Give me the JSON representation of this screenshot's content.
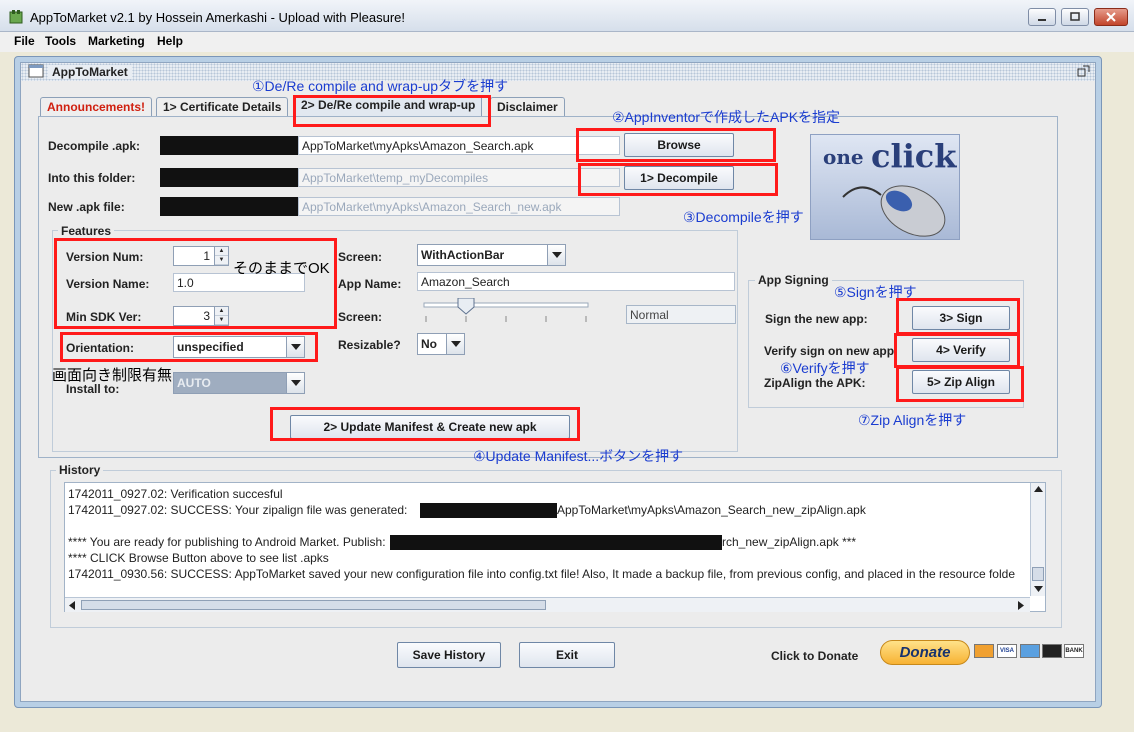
{
  "window": {
    "title": "AppToMarket v2.1 by Hossein Amerkashi - Upload with Pleasure!"
  },
  "menu": [
    "File",
    "Tools",
    "Marketing",
    "Help"
  ],
  "inner_title": "AppToMarket",
  "tabs": [
    "Announcements!",
    "1> Certificate Details",
    "2> De/Re compile and wrap-up",
    "Disclaimer"
  ],
  "form": {
    "decompile_label": "Decompile .apk:",
    "decompile_value": "AppToMarket\\myApks\\Amazon_Search.apk",
    "browse_label": "Browse",
    "folder_label": "Into this folder:",
    "folder_value": "AppToMarket\\temp_myDecompiles",
    "decompile_button": "1> Decompile",
    "newapk_label": "New .apk file:",
    "newapk_value": "AppToMarket\\myApks\\Amazon_Search_new.apk"
  },
  "logo": {
    "text_one": "one",
    "text_click": "click"
  },
  "features": {
    "title": "Features",
    "version_num_label": "Version Num:",
    "version_num_value": "1",
    "version_name_label": "Version Name:",
    "version_name_value": "1.0",
    "min_sdk_label": "Min SDK Ver:",
    "min_sdk_value": "3",
    "orientation_label": "Orientation:",
    "orientation_value": "unspecified",
    "install_label": "Install to:",
    "install_value": "AUTO",
    "screen_label": "Screen:",
    "screen_value": "WithActionBar",
    "appname_label": "App Name:",
    "appname_value": "Amazon_Search",
    "screen2_label": "Screen:",
    "screen2_value": "Normal",
    "resizable_label": "Resizable?",
    "resizable_value": "No",
    "update_button": "2> Update Manifest & Create new apk"
  },
  "signing": {
    "title": "App Signing",
    "sign_label": "Sign the new app:",
    "sign_button": "3> Sign",
    "verify_label": "Verify sign on new app",
    "verify_button": "4> Verify",
    "zip_label": "ZipAlign the APK:",
    "zip_button": "5> Zip Align"
  },
  "notes": {
    "n1": "①De/Re compile and wrap-upタブを押す",
    "n2": "②AppInventorで作成したAPKを指定",
    "n3": "③Decompileを押す",
    "n4": "④Update Manifest...ボタンを押す",
    "n5": "⑤Signを押す",
    "n6": "⑥Verifyを押す",
    "n7": "⑦Zip Alignを押す",
    "keep": "そのままでOK",
    "orient": "画面向き制限有無"
  },
  "history": {
    "title": "History",
    "lines": [
      "1742011_0927.02:  Verification succesful",
      "1742011_0927.02:  SUCCESS: Your zipalign file was generated:",
      "AppToMarket\\myApks\\Amazon_Search_new_zipAlign.apk",
      "**** You are ready for publishing to Android Market. Publish:",
      "rch_new_zipAlign.apk ***",
      "**** CLICK Browse Button above to see list .apks",
      "1742011_0930.56:  SUCCESS: AppToMarket saved your new configuration file into config.txt file! Also, It made a backup file, from previous config, and placed in the resource folde"
    ]
  },
  "footer": {
    "save_history": "Save History",
    "exit": "Exit",
    "click_to_donate": "Click to Donate",
    "donate": "Donate",
    "cards": [
      "VISA",
      "BANK"
    ]
  }
}
